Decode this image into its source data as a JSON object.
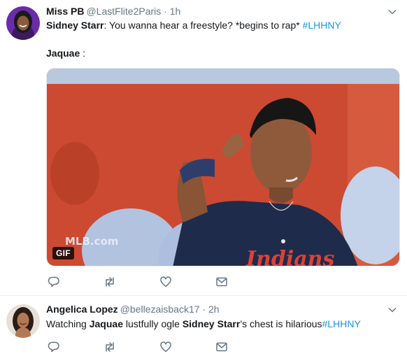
{
  "tweets": [
    {
      "author": {
        "name": "Miss PB",
        "handle": "@LastFlite2Paris",
        "time": "1h"
      },
      "text": {
        "name": "Sidney Starr",
        "body": ": You wanna hear a freestyle? *begins to rap* ",
        "hashtag": "#LHHNY"
      },
      "text2": {
        "name": "Jaquae",
        "body": " :"
      },
      "media": {
        "badge": "GIF",
        "watermark": "MLB.com"
      }
    },
    {
      "author": {
        "name": "Angelica Lopez",
        "handle": "@bellezaisback17",
        "time": "2h"
      },
      "text": {
        "p1": "Watching ",
        "name1": "Jaquae",
        "p2": " lustfully ogle ",
        "name2": "Sidney Starr",
        "p3": "’s chest is hilarious",
        "hashtag": "#LHHNY"
      }
    }
  ],
  "separator": " · ",
  "icons": [
    "reply-icon",
    "retweet-icon",
    "like-icon",
    "dm-icon",
    "chevron-down-icon"
  ],
  "colors": {
    "link": "#1b95e0",
    "secondary": "#657786",
    "border": "#e6ecf0"
  }
}
